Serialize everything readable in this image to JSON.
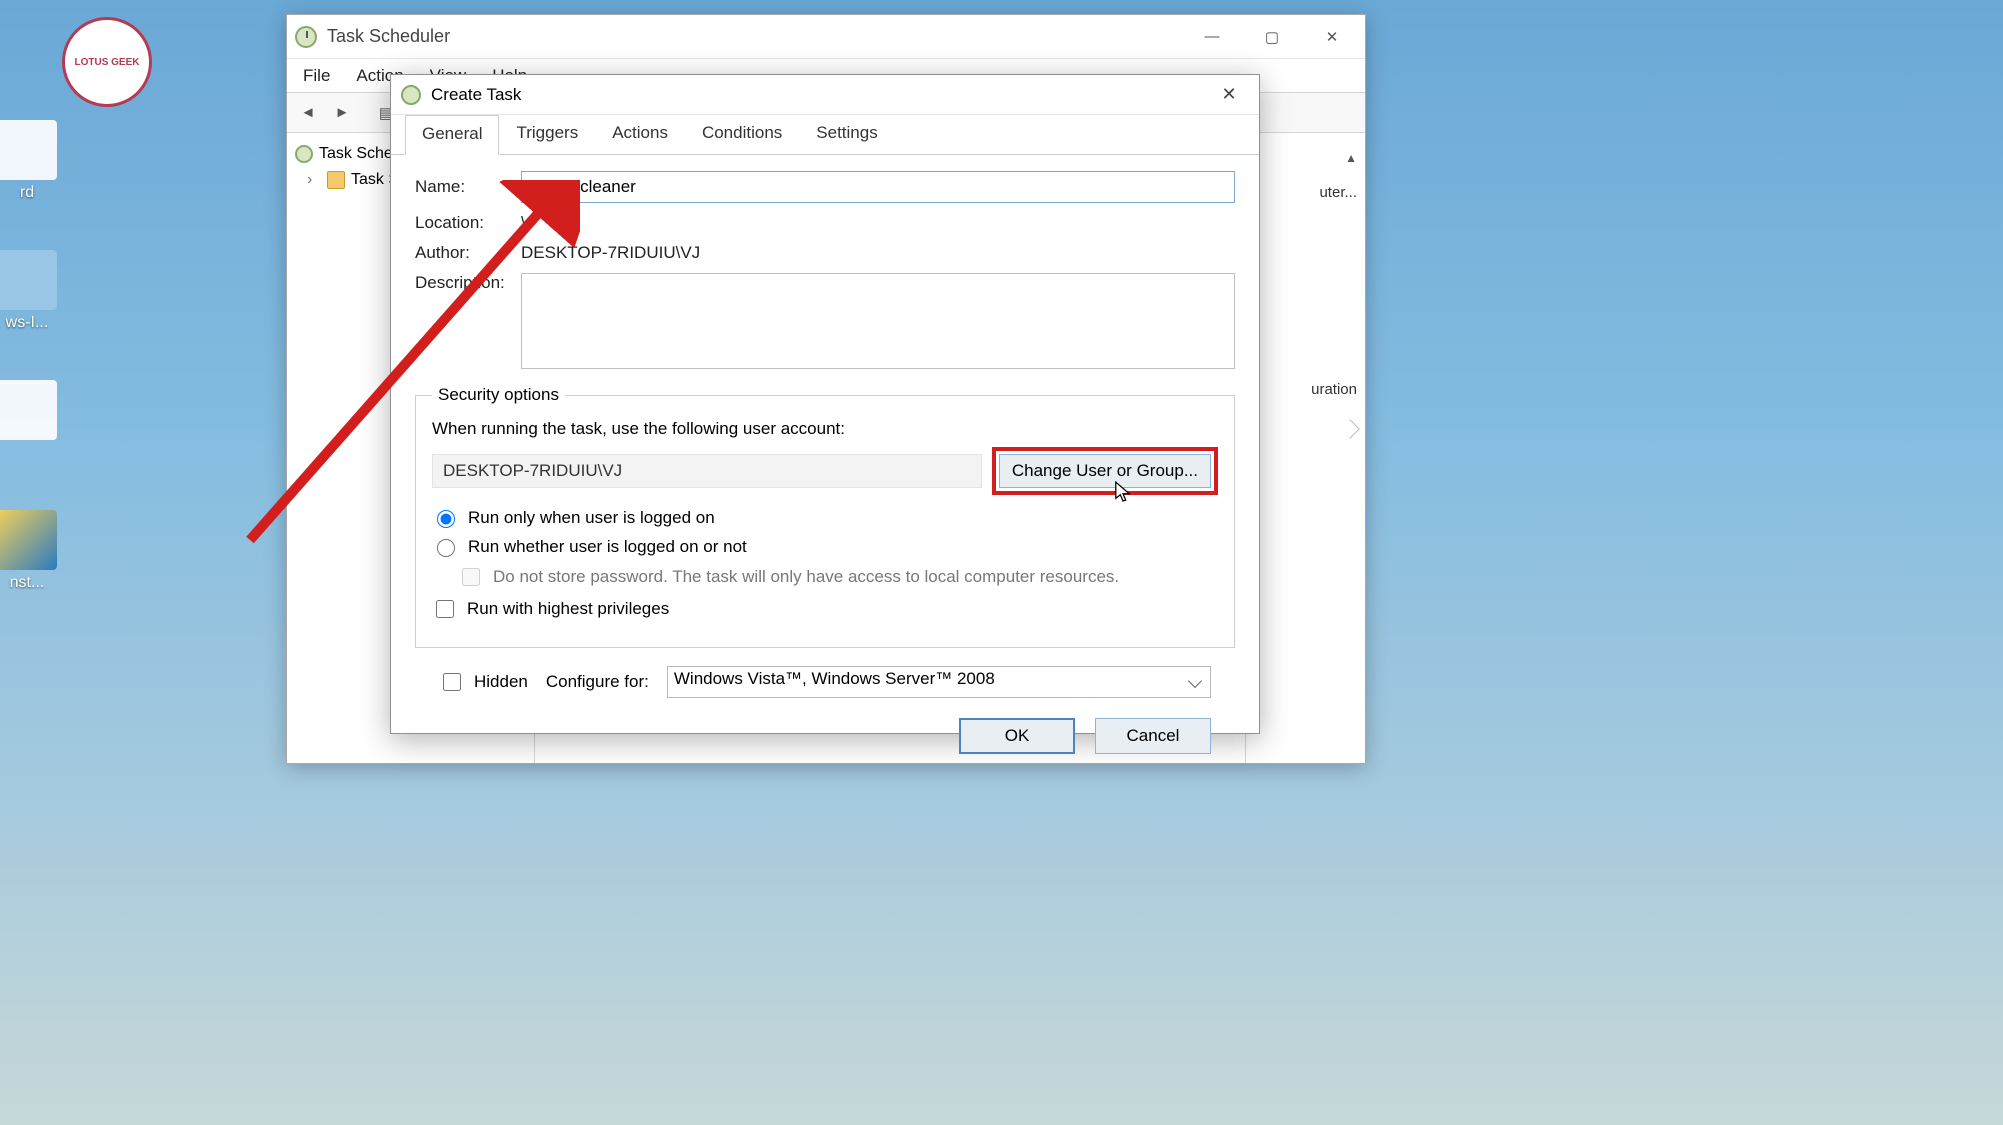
{
  "desktop": {
    "icons": [
      {
        "label": "rd"
      },
      {
        "label": "ws-I..."
      },
      {
        "label": ""
      },
      {
        "label": "nst..."
      }
    ],
    "logo_text": "LOTUS GEEK"
  },
  "main_window": {
    "title": "Task Scheduler",
    "menus": [
      "File",
      "Action",
      "View",
      "Help"
    ],
    "tree": {
      "root": "Task Scheduler (Local)",
      "child": "Task Scheduler Library"
    },
    "right_panel": {
      "line1": "uter...",
      "line2": "uration"
    }
  },
  "dialog": {
    "title": "Create Task",
    "tabs": [
      "General",
      "Triggers",
      "Actions",
      "Conditions",
      "Settings"
    ],
    "active_tab": 0,
    "labels": {
      "name": "Name:",
      "location": "Location:",
      "author": "Author:",
      "description": "Description:"
    },
    "fields": {
      "name": "cache cleaner",
      "location": "\\",
      "author": "DESKTOP-7RIDUIU\\VJ",
      "description": ""
    },
    "security": {
      "legend": "Security options",
      "msg": "When running the task, use the following user account:",
      "user": "DESKTOP-7RIDUIU\\VJ",
      "change_btn": "Change User or Group...",
      "radio1": "Run only when user is logged on",
      "radio2": "Run whether user is logged on or not",
      "nopwd": "Do not store password.  The task will only have access to local computer resources.",
      "highpriv": "Run with highest privileges"
    },
    "bottom": {
      "hidden": "Hidden",
      "configure_label": "Configure for:",
      "configure_value": "Windows Vista™, Windows Server™ 2008"
    },
    "buttons": {
      "ok": "OK",
      "cancel": "Cancel"
    }
  }
}
